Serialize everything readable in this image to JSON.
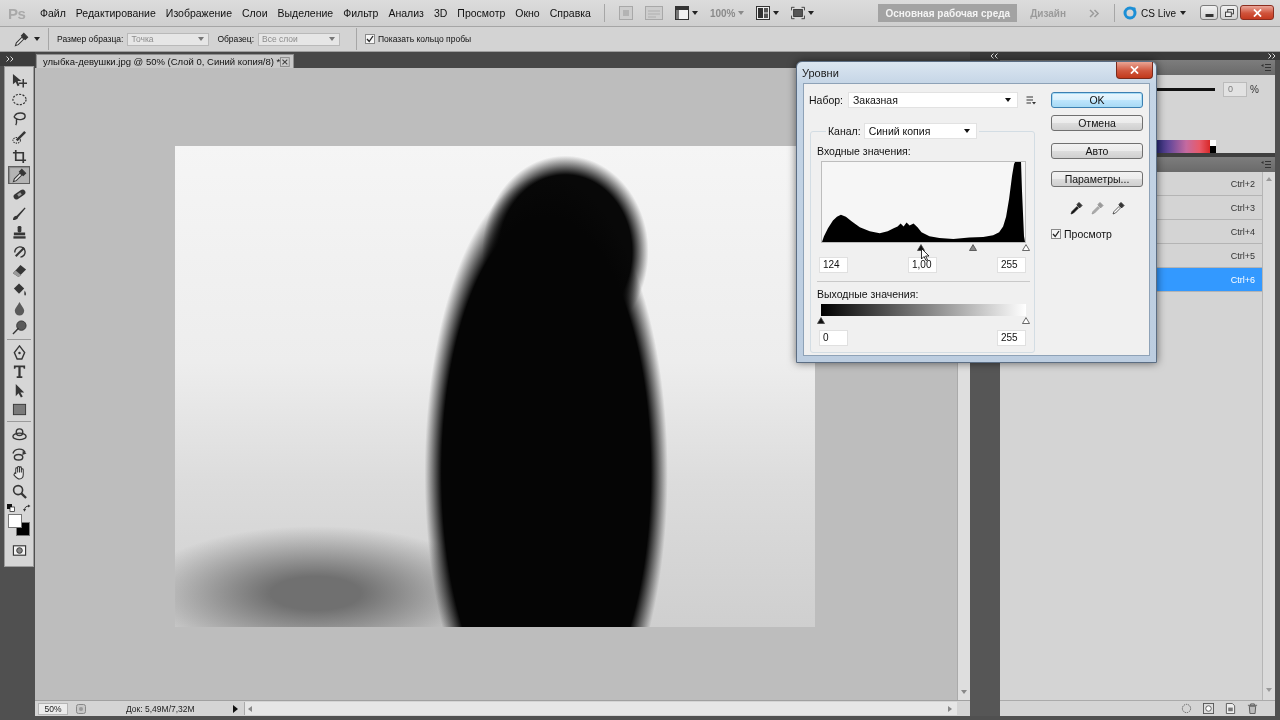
{
  "app_bar": {
    "logo": "Ps",
    "menus": [
      "Файл",
      "Редактирование",
      "Изображение",
      "Слои",
      "Выделение",
      "Фильтр",
      "Анализ",
      "3D",
      "Просмотр",
      "Окно",
      "Справка"
    ],
    "zoom": {
      "value": "100%",
      "disabled": true
    },
    "workspaces": [
      {
        "label": "Основная рабочая среда",
        "selected": true
      },
      {
        "label": "Дизайн",
        "selected": false
      }
    ],
    "cs_live": "CS Live"
  },
  "options_bar": {
    "sample_size": {
      "label": "Размер образца:",
      "value": "Точка",
      "disabled": true
    },
    "sample": {
      "label": "Образец:",
      "value": "Все слои",
      "disabled": true
    },
    "sample_ring": {
      "label": "Показать кольцо пробы",
      "checked": true
    }
  },
  "tool_groups": [
    [
      {
        "kind": "move",
        "selected": false
      },
      {
        "kind": "marquee",
        "selected": false
      },
      {
        "kind": "lasso",
        "selected": false
      },
      {
        "kind": "quickselect",
        "selected": false
      },
      {
        "kind": "crop",
        "selected": false
      },
      {
        "kind": "eyedropper",
        "selected": true
      },
      {
        "kind": "healing",
        "selected": false
      },
      {
        "kind": "brush",
        "selected": false
      },
      {
        "kind": "stamp",
        "selected": false
      },
      {
        "kind": "historybrush",
        "selected": false
      },
      {
        "kind": "eraser",
        "selected": false
      },
      {
        "kind": "bucket",
        "selected": false
      },
      {
        "kind": "blur",
        "selected": false
      },
      {
        "kind": "dodge",
        "selected": false
      }
    ],
    [
      {
        "kind": "pen",
        "selected": false
      },
      {
        "kind": "type",
        "selected": false
      },
      {
        "kind": "pathselect",
        "selected": false
      },
      {
        "kind": "shape",
        "selected": false
      }
    ],
    [
      {
        "kind": "rotate3d",
        "selected": false
      },
      {
        "kind": "orbit3d",
        "selected": false
      },
      {
        "kind": "hand",
        "selected": false
      },
      {
        "kind": "zoom",
        "selected": false
      }
    ]
  ],
  "document": {
    "tab_title": "улыбка-девушки.jpg @ 50% (Слой 0, Синий копия/8) *",
    "zoom": "50%",
    "doc_info": "Док: 5,49M/7,32M"
  },
  "panels": {
    "adjust": {
      "value": "0",
      "unit": "%",
      "disabled": true
    },
    "channels": [
      {
        "shortcut": "Ctrl+2",
        "selected": false
      },
      {
        "shortcut": "Ctrl+3",
        "selected": false
      },
      {
        "shortcut": "Ctrl+4",
        "selected": false
      },
      {
        "shortcut": "Ctrl+5",
        "selected": false
      },
      {
        "shortcut": "Ctrl+6",
        "selected": true
      }
    ]
  },
  "levels_dialog": {
    "title": "Уровни",
    "preset": {
      "label": "Набор:",
      "value": "Заказная"
    },
    "channel": {
      "label": "Канал:",
      "value": "Синий копия"
    },
    "input": {
      "label": "Входные значения:",
      "sliders": [
        {
          "kind": "black",
          "level": 0.486
        },
        {
          "kind": "gray",
          "level": 0.743
        },
        {
          "kind": "white",
          "level": 1
        }
      ],
      "values": [
        "124",
        "1,00",
        "255"
      ]
    },
    "output": {
      "label": "Выходные значения:",
      "sliders": [
        {
          "kind": "black",
          "level": 0
        },
        {
          "kind": "white",
          "level": 1
        }
      ],
      "values": [
        "0",
        "255"
      ]
    },
    "buttons": [
      {
        "label": "OK",
        "default": true
      },
      {
        "label": "Отмена",
        "default": false
      },
      {
        "label": "Авто",
        "default": false
      },
      {
        "label": "Параметры...",
        "default": false
      }
    ],
    "preview": {
      "label": "Просмотр",
      "checked": true
    }
  }
}
